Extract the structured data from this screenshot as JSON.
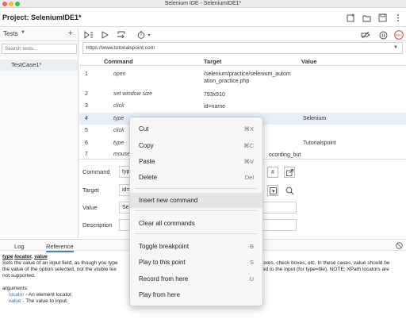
{
  "window": {
    "title": "Selenium IDE - SeleniumIDE1*"
  },
  "project": {
    "label": "Project:  SeleniumIDE1*"
  },
  "sidebar": {
    "tests_label": "Tests",
    "search_placeholder": "Search tests...",
    "test_cases": [
      "TestCase1*"
    ]
  },
  "url_bar": {
    "value": "https://www.tutorialspoint.com"
  },
  "table": {
    "columns": [
      "Command",
      "Target",
      "Value"
    ],
    "rows": [
      {
        "num": "1",
        "command": "open",
        "target": "/selenium/practice/selenium_autom ation_practice.php",
        "value": ""
      },
      {
        "num": "2",
        "command": "set window size",
        "target": "793x910",
        "value": ""
      },
      {
        "num": "3",
        "command": "click",
        "target": "id=name",
        "value": ""
      },
      {
        "num": "4",
        "command": "type",
        "target": "",
        "value": "Selenium"
      },
      {
        "num": "5",
        "command": "click",
        "target": "",
        "value": ""
      },
      {
        "num": "6",
        "command": "type",
        "target": "",
        "value": "Tutorialspoint"
      },
      {
        "num": "7",
        "command": "mouse",
        "target": "ocording_but",
        "value": ""
      }
    ]
  },
  "editor": {
    "command_label": "Command",
    "target_label": "Target",
    "value_label": "Value",
    "description_label": "Description",
    "command_value": "typ",
    "target_value": "id=",
    "value_value": "Se",
    "hash_button": "#"
  },
  "bottom": {
    "tabs": [
      "Log",
      "Reference"
    ],
    "reference": {
      "signature_cmd": "type",
      "signature_locator": "locator",
      "signature_value": "value",
      "desc1": "Sets the value of an input field, as though you type",
      "desc1b": "oxes, check boxes, etc. In these cases, value should be",
      "desc2": "the value of the option selected, not the visible tex",
      "desc2b": "ed to the input (for type=file), NOTE: XPath locators are",
      "desc3": "not supported.",
      "args_label": "arguments:",
      "arg1_name": "locator",
      "arg1_desc": " - An element locator.",
      "arg2_name": "value",
      "arg2_desc": " - The value to input."
    }
  },
  "context_menu": {
    "items": [
      {
        "label": "Cut",
        "shortcut": "⌘X"
      },
      {
        "label": "Copy",
        "shortcut": "⌘C"
      },
      {
        "label": "Paste",
        "shortcut": "⌘V"
      },
      {
        "label": "Delete",
        "shortcut": "Del"
      },
      {
        "label": "Insert new command",
        "shortcut": ""
      },
      {
        "label": "Clear all commands",
        "shortcut": ""
      },
      {
        "label": "Toggle breakpoint",
        "shortcut": "B"
      },
      {
        "label": "Play to this point",
        "shortcut": "S"
      },
      {
        "label": "Record from here",
        "shortcut": "U"
      },
      {
        "label": "Play from here",
        "shortcut": ""
      }
    ]
  },
  "colors": {
    "accent": "#4a7fd0",
    "record": "#d9362b",
    "selected_row": "#e6eef9"
  }
}
